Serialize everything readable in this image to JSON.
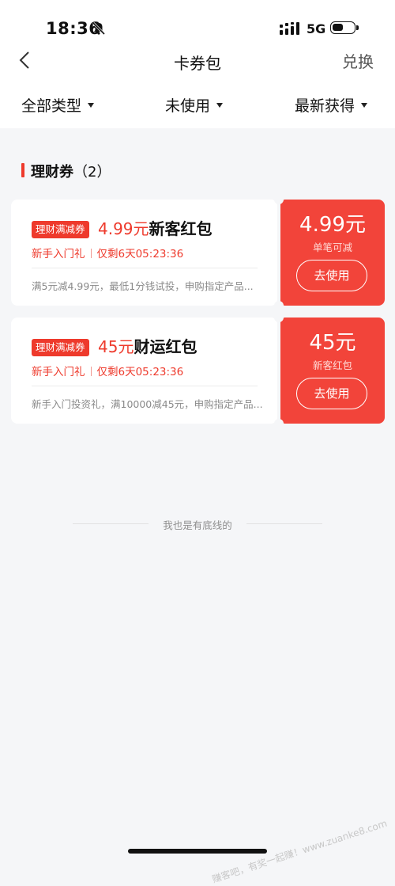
{
  "status_bar": {
    "time": "18:36",
    "network": "5G",
    "icons": [
      "bell-muted-icon",
      "signal-icon",
      "battery-icon"
    ]
  },
  "nav": {
    "back_icon": "chevron-left-icon",
    "title": "卡券包",
    "action": "兑换"
  },
  "filters": [
    {
      "label": "全部类型"
    },
    {
      "label": "未使用"
    },
    {
      "label": "最新获得"
    }
  ],
  "section": {
    "title": "理财券",
    "count": "（2）"
  },
  "coupons": [
    {
      "tag": "理财满减券",
      "amount": "4.99元",
      "name": "新客红包",
      "sub_left": "新手入门礼",
      "sub_right": "仅剩6天05:23:36",
      "desc": "满5元减4.99元，最低1分钱试投，申购指定产品...",
      "value": "4.99元",
      "value_sub": "单笔可减",
      "button": "去使用"
    },
    {
      "tag": "理财满减券",
      "amount": "45元",
      "name": "财运红包",
      "sub_left": "新手入门礼",
      "sub_right": "仅剩6天05:23:36",
      "desc": "新手入门投资礼，满10000减45元，申购指定产品...",
      "value": "45元",
      "value_sub": "新客红包",
      "button": "去使用"
    }
  ],
  "footer_text": "我也是有底线的",
  "watermark": "赚客吧，有奖一起赚！www.zuanke8.com",
  "colors": {
    "accent": "#ee3a2c",
    "coupon_right": "#f2443a",
    "background": "#f5f6f8"
  }
}
